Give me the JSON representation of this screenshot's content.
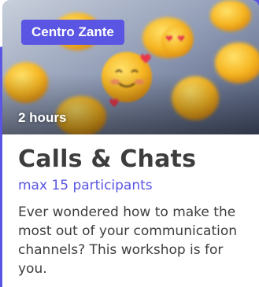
{
  "card": {
    "tag_label": "Centro Zante",
    "duration": "2 hours",
    "title": "Calls & Chats",
    "subtitle": "max 15 participants",
    "description": "Ever wondered how to make the most out of your communication channels? This workshop is for you.",
    "image_subject": "emoji-faces-photo"
  },
  "colors": {
    "accent": "#5a55e3",
    "title_text": "#3d3d3d",
    "body_text": "#3d3d3d",
    "tag_text": "#ffffff"
  }
}
